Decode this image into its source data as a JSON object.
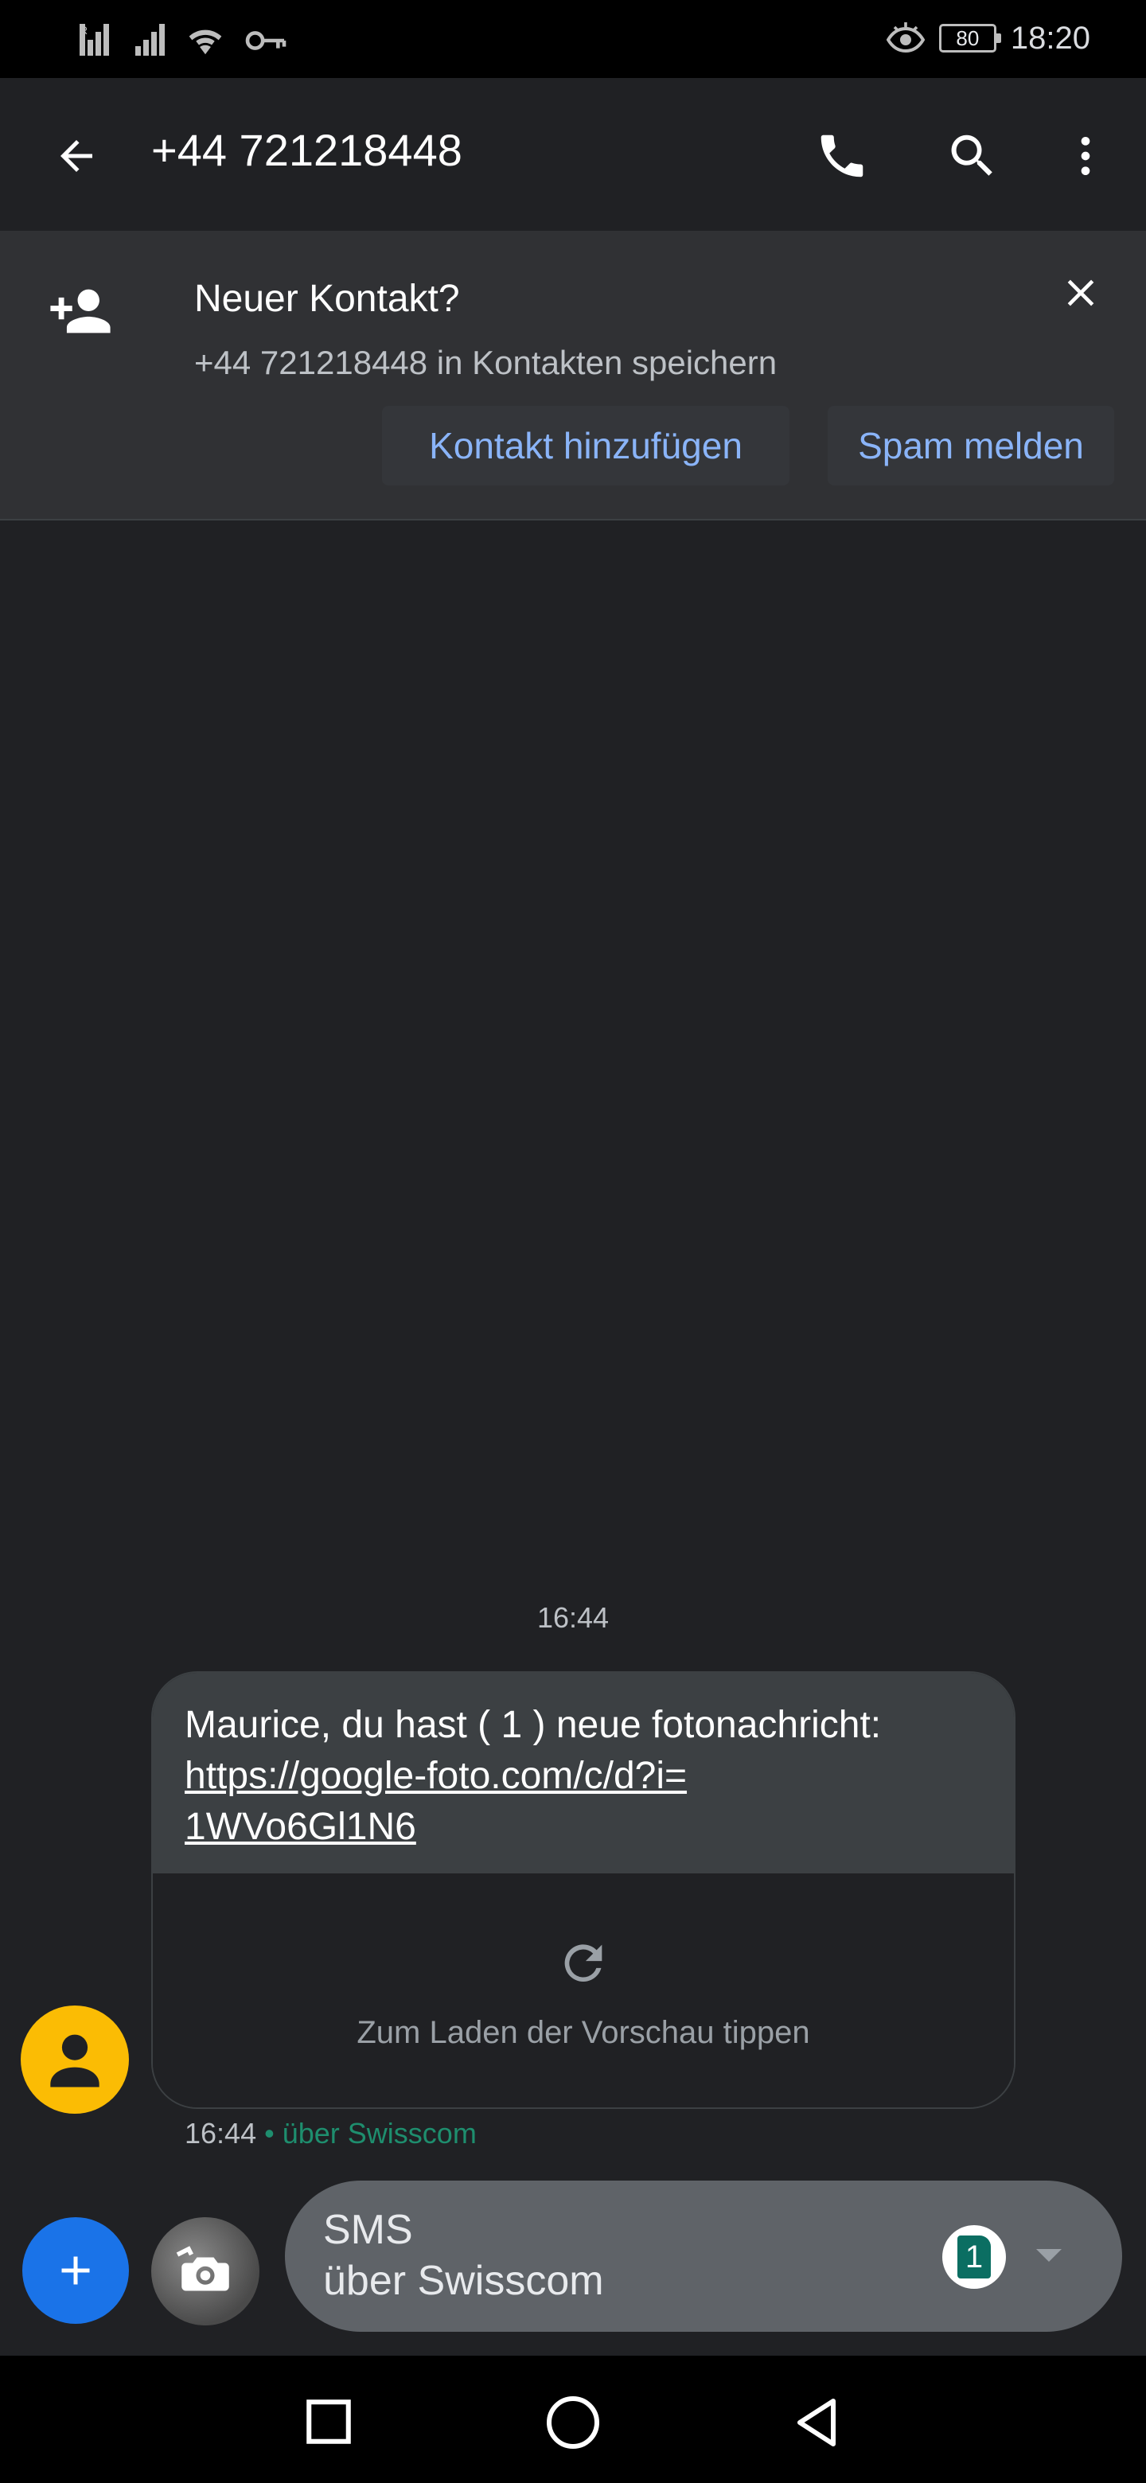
{
  "status_bar": {
    "time": "18:20",
    "battery": "80",
    "icons": [
      "signal-icon",
      "signal-icon",
      "wifi-icon",
      "vpn-key-icon",
      "eye-comfort-icon",
      "battery-icon"
    ]
  },
  "app_bar": {
    "title": "+44 721218448",
    "icons": [
      "back-arrow-icon",
      "phone-icon",
      "search-icon",
      "more-vert-icon"
    ]
  },
  "banner": {
    "title": "Neuer Kontakt?",
    "subtitle": "+44 721218448 in Kontakten speichern",
    "add_contact_label": "Kontakt hinzufügen",
    "report_spam_label": "Spam melden",
    "icons": [
      "person-add-icon",
      "close-icon"
    ]
  },
  "conversation": {
    "timestamp": "16:44",
    "message": {
      "text": "Maurice, du hast ( 1 ) neue fotonachricht:",
      "link": "https://google-foto.com/c/d?i=",
      "link_cont": "1WVo6Gl1N6",
      "preview_label": "Zum Laden der Vorschau tippen",
      "time": "16:44",
      "separator": "•",
      "via": "über Swisscom"
    }
  },
  "compose": {
    "line1": "SMS",
    "line2": "über Swisscom",
    "sim_number": "1",
    "icons": [
      "add-icon",
      "camera-gallery-icon",
      "dropdown-icon"
    ]
  },
  "nav_bar": {
    "icons": [
      "recents-square-icon",
      "home-circle-icon",
      "back-triangle-icon"
    ]
  },
  "colors": {
    "background": "#202124",
    "banner": "#303134",
    "bubble": "#3c4043",
    "link_blue": "#8ab4f8",
    "fab_blue": "#1a73e8",
    "avatar_yellow": "#fbbc04",
    "via_green": "#1e8e6e"
  }
}
